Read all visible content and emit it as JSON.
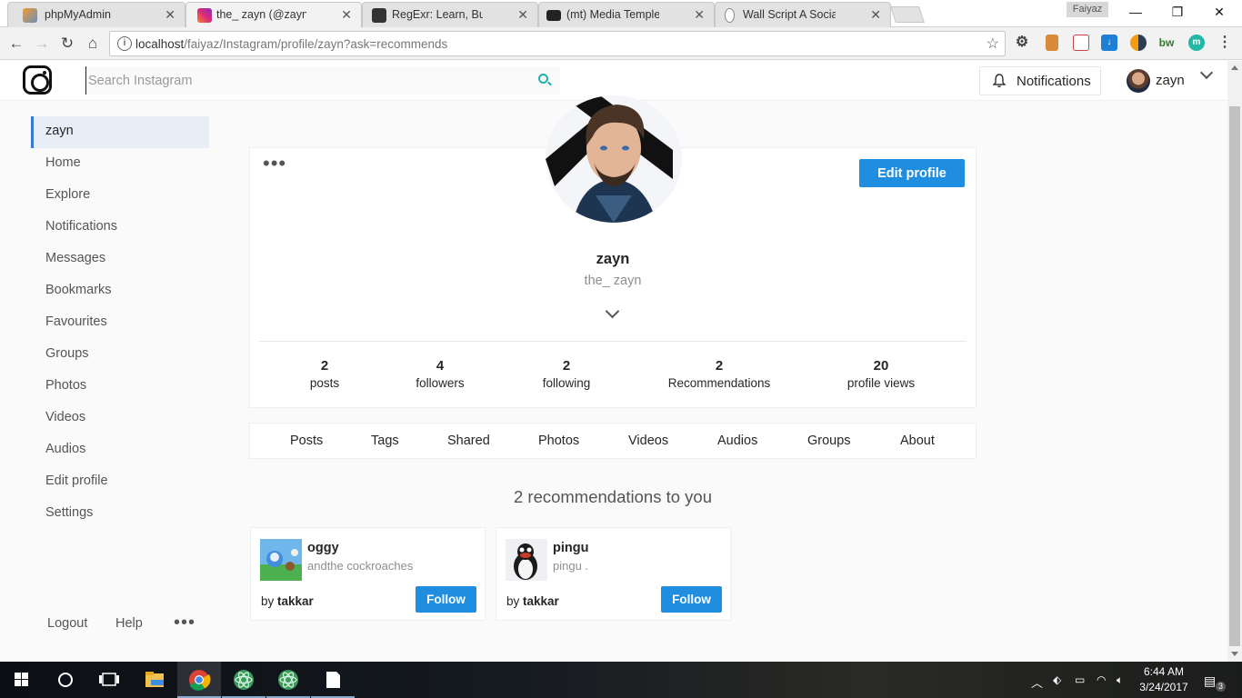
{
  "browser": {
    "tabs": [
      {
        "title": "phpMyAdmin",
        "active": false,
        "icon": "phpmyadmin-icon"
      },
      {
        "title": "the_ zayn (@zayn) | Instagram",
        "active": true,
        "icon": "instagram-icon"
      },
      {
        "title": "RegExr: Learn, Build, & Test RegEx",
        "active": false,
        "icon": "regexr-icon"
      },
      {
        "title": "(mt) Media Temple - Support",
        "active": false,
        "icon": "mediatemple-icon"
      },
      {
        "title": "Wall Script A Social Network",
        "active": false,
        "icon": "wallscript-icon"
      }
    ],
    "profile_name": "Faiyaz",
    "url_host": "localhost",
    "url_path": "/faiyaz/Instagram/profile/zayn?ask=recommends"
  },
  "header": {
    "search_placeholder": "Search Instagram",
    "notifications_label": "Notifications",
    "user_name": "zayn"
  },
  "sidebar": {
    "items": [
      {
        "label": "zayn",
        "active": true
      },
      {
        "label": "Home"
      },
      {
        "label": "Explore"
      },
      {
        "label": "Notifications"
      },
      {
        "label": "Messages"
      },
      {
        "label": "Bookmarks"
      },
      {
        "label": "Favourites"
      },
      {
        "label": "Groups"
      },
      {
        "label": "Photos"
      },
      {
        "label": "Videos"
      },
      {
        "label": "Audios"
      },
      {
        "label": "Edit profile"
      },
      {
        "label": "Settings"
      }
    ],
    "logout": "Logout",
    "help": "Help"
  },
  "profile": {
    "edit_label": "Edit profile",
    "name": "zayn",
    "handle": "the_ zayn",
    "stats": [
      {
        "value": "2",
        "label": "posts"
      },
      {
        "value": "4",
        "label": "followers"
      },
      {
        "value": "2",
        "label": "following"
      },
      {
        "value": "2",
        "label": "Recommendations"
      },
      {
        "value": "20",
        "label": "profile views"
      }
    ],
    "tabs": [
      "Posts",
      "Tags",
      "Shared",
      "Photos",
      "Videos",
      "Audios",
      "Groups",
      "About"
    ]
  },
  "recommendations": {
    "heading": "2 recommendations to you",
    "items": [
      {
        "name": "oggy",
        "subtitle": "andthe cockroaches",
        "by_prefix": "by",
        "by_user": "takkar",
        "follow": "Follow"
      },
      {
        "name": "pingu",
        "subtitle": "pingu .",
        "by_prefix": "by",
        "by_user": "takkar",
        "follow": "Follow"
      }
    ]
  },
  "taskbar": {
    "time": "6:44 AM",
    "date": "3/24/2017",
    "notification_count": "3"
  },
  "colors": {
    "accent": "#1f8ee0",
    "search_icon": "#20b2aa",
    "sidebar_active": "#3a78d8"
  }
}
